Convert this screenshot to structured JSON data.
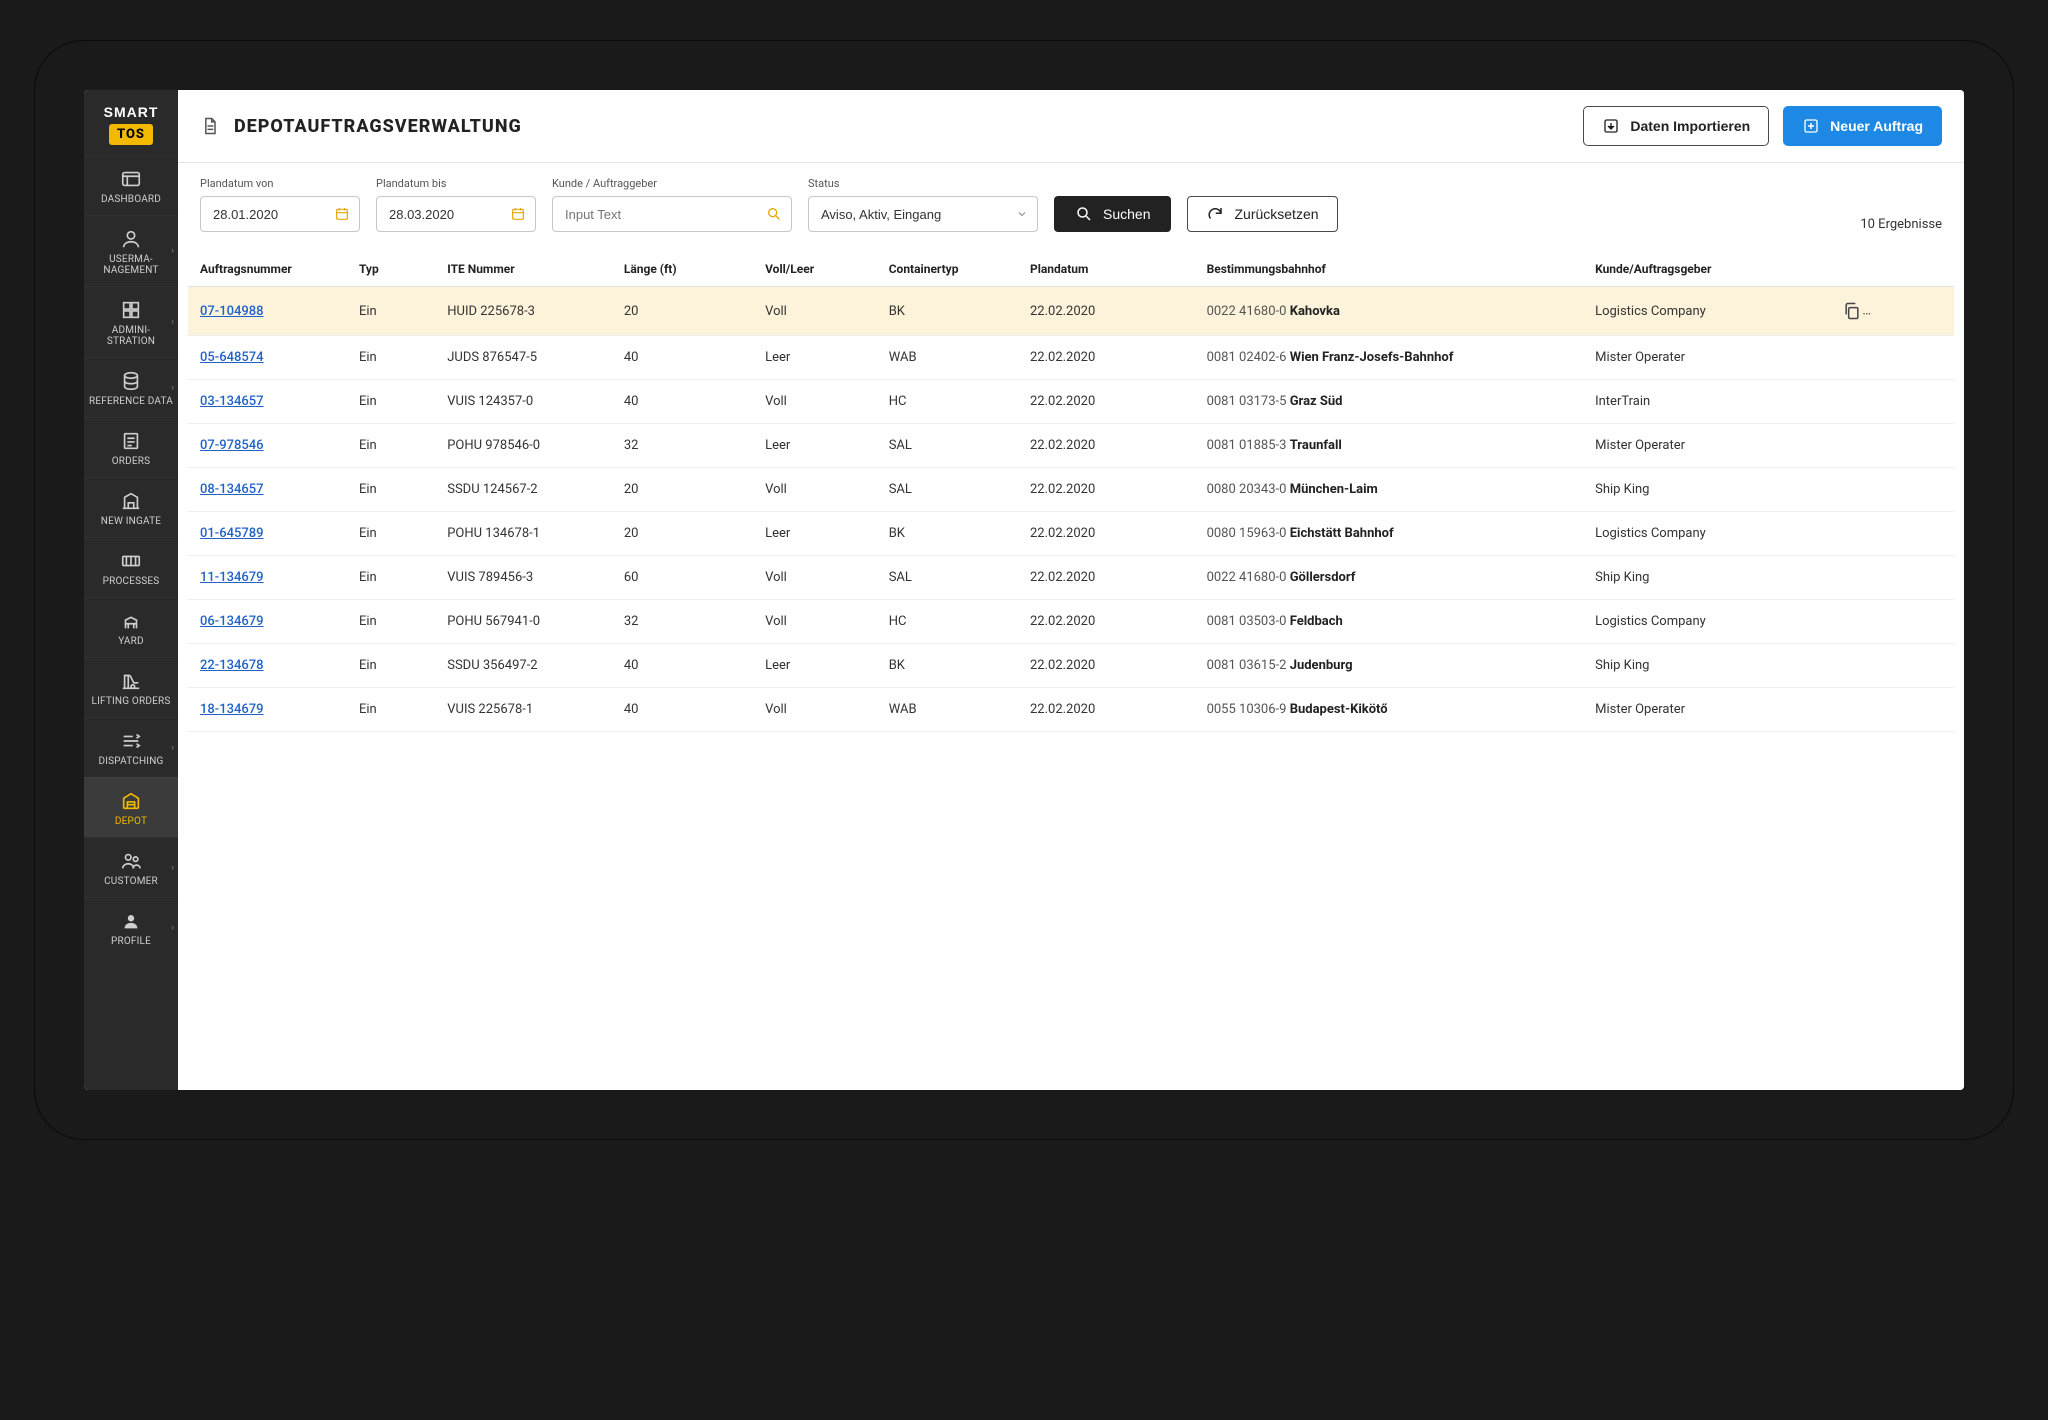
{
  "brand": {
    "top": "SMART",
    "bottom": "TOS"
  },
  "sidebar": {
    "items": [
      {
        "label": "DASHBOARD",
        "active": false,
        "expandable": false
      },
      {
        "label": "USERMA-NAGEMENT",
        "active": false,
        "expandable": true
      },
      {
        "label": "ADMINI-STRATION",
        "active": false,
        "expandable": true
      },
      {
        "label": "REFERENCE DATA",
        "active": false,
        "expandable": true
      },
      {
        "label": "ORDERS",
        "active": false,
        "expandable": false
      },
      {
        "label": "NEW INGATE",
        "active": false,
        "expandable": false
      },
      {
        "label": "PROCESSES",
        "active": false,
        "expandable": false
      },
      {
        "label": "YARD",
        "active": false,
        "expandable": false
      },
      {
        "label": "LIFTING ORDERS",
        "active": false,
        "expandable": false
      },
      {
        "label": "DISPATCHING",
        "active": false,
        "expandable": true
      },
      {
        "label": "DEPOT",
        "active": true,
        "expandable": false
      },
      {
        "label": "CUSTOMER",
        "active": false,
        "expandable": true
      },
      {
        "label": "PROFILE",
        "active": false,
        "expandable": true
      }
    ]
  },
  "header": {
    "title": "DEPOTAUFTRAGSVERWALTUNG",
    "import_label": "Daten Importieren",
    "new_label": "Neuer Auftrag"
  },
  "filters": {
    "date_from": {
      "label": "Plandatum von",
      "value": "28.01.2020"
    },
    "date_to": {
      "label": "Plandatum bis",
      "value": "28.03.2020"
    },
    "customer": {
      "label": "Kunde / Auftraggeber",
      "placeholder": "Input Text",
      "value": ""
    },
    "status": {
      "label": "Status",
      "value": "Aviso, Aktiv, Eingang"
    },
    "search_label": "Suchen",
    "reset_label": "Zurücksetzen",
    "results_label": "10 Ergebnisse"
  },
  "table": {
    "columns": {
      "auftrag": "Auftragsnummer",
      "typ": "Typ",
      "ite": "ITE Nummer",
      "laenge": "Länge (ft)",
      "voll": "Voll/Leer",
      "ctyp": "Containertyp",
      "plan": "Plandatum",
      "dest": "Bestimmungsbahnhof",
      "kunde": "Kunde/Auftragsgeber"
    },
    "rows": [
      {
        "id": "07-104988",
        "typ": "Ein",
        "ite": "HUID 225678-3",
        "laenge": "20",
        "voll": "Voll",
        "ctyp": "BK",
        "plan": "22.02.2020",
        "dest_code": "0022 41680-0",
        "dest_name": "Kahovka",
        "kunde": "Logistics Company",
        "highlight": true
      },
      {
        "id": "05-648574",
        "typ": "Ein",
        "ite": "JUDS 876547-5",
        "laenge": "40",
        "voll": "Leer",
        "ctyp": "WAB",
        "plan": "22.02.2020",
        "dest_code": "0081 02402-6",
        "dest_name": "Wien Franz-Josefs-Bahnhof",
        "kunde": "Mister Operater"
      },
      {
        "id": "03-134657",
        "typ": "Ein",
        "ite": "VUIS 124357-0",
        "laenge": "40",
        "voll": "Voll",
        "ctyp": "HC",
        "plan": "22.02.2020",
        "dest_code": "0081 03173-5",
        "dest_name": "Graz Süd",
        "kunde": "InterTrain"
      },
      {
        "id": "07-978546",
        "typ": "Ein",
        "ite": "POHU 978546-0",
        "laenge": "32",
        "voll": "Leer",
        "ctyp": "SAL",
        "plan": "22.02.2020",
        "dest_code": "0081 01885-3",
        "dest_name": "Traunfall",
        "kunde": "Mister Operater"
      },
      {
        "id": "08-134657",
        "typ": "Ein",
        "ite": "SSDU 124567-2",
        "laenge": "20",
        "voll": "Voll",
        "ctyp": "SAL",
        "plan": "22.02.2020",
        "dest_code": "0080 20343-0",
        "dest_name": "München-Laim",
        "kunde": "Ship King"
      },
      {
        "id": "01-645789",
        "typ": "Ein",
        "ite": "POHU 134678-1",
        "laenge": "20",
        "voll": "Leer",
        "ctyp": "BK",
        "plan": "22.02.2020",
        "dest_code": "0080 15963-0",
        "dest_name": "Eichstätt Bahnhof",
        "kunde": "Logistics Company"
      },
      {
        "id": "11-134679",
        "typ": "Ein",
        "ite": "VUIS 789456-3",
        "laenge": "60",
        "voll": "Voll",
        "ctyp": "SAL",
        "plan": "22.02.2020",
        "dest_code": "0022 41680-0",
        "dest_name": "Göllersdorf",
        "kunde": "Ship King"
      },
      {
        "id": "06-134679",
        "typ": "Ein",
        "ite": "POHU 567941-0",
        "laenge": "32",
        "voll": "Voll",
        "ctyp": "HC",
        "plan": "22.02.2020",
        "dest_code": "0081 03503-0",
        "dest_name": "Feldbach",
        "kunde": "Logistics Company"
      },
      {
        "id": "22-134678",
        "typ": "Ein",
        "ite": "SSDU 356497-2",
        "laenge": "40",
        "voll": "Leer",
        "ctyp": "BK",
        "plan": "22.02.2020",
        "dest_code": "0081 03615-2",
        "dest_name": "Judenburg",
        "kunde": "Ship King"
      },
      {
        "id": "18-134679",
        "typ": "Ein",
        "ite": "VUIS 225678-1",
        "laenge": "40",
        "voll": "Voll",
        "ctyp": "WAB",
        "plan": "22.02.2020",
        "dest_code": "0055 10306-9",
        "dest_name": "Budapest-Kikötő",
        "kunde": "Mister Operater"
      }
    ]
  }
}
